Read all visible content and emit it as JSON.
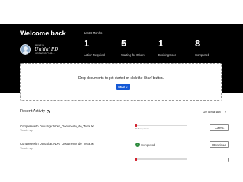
{
  "header": {
    "welcome": "Welcome back",
    "signature": {
      "signed_by": "Signed by:",
      "name": "Unidal PD",
      "code": "969FAE3DF94B..."
    },
    "period": "Last 6 Months",
    "stats": [
      {
        "value": "1",
        "label": "Action Required"
      },
      {
        "value": "5",
        "label": "Waiting for Others"
      },
      {
        "value": "1",
        "label": "Expiring Soon"
      },
      {
        "value": "8",
        "label": "Completed"
      }
    ]
  },
  "dropzone": {
    "text": "Drop documents to get started or click the 'Start' button.",
    "start_label": "Start",
    "start_arrow": "▾"
  },
  "recent_activity": {
    "title": "Recent Activity",
    "info_icon": "ⓘ",
    "manage_link": "Go to Manage",
    "manage_chevron": "›",
    "rows": [
      {
        "title": "Complete with DocuSign: Novo_Documento_de_Teste.txt",
        "time": "2 weeks ago",
        "status_type": "progress",
        "progress": 0.0,
        "status_label": "Delivery failure",
        "button": "Correct"
      },
      {
        "title": "Complete with DocuSign: Novo_Documento_de_Teste.txt",
        "time": "2 weeks ago",
        "status_type": "completed",
        "status_label": "Completed",
        "button": "Download"
      }
    ]
  },
  "colors": {
    "header_bg": "#000000",
    "primary_button": "#1559d6",
    "error": "#d21f2b",
    "success": "#2e8b3e"
  }
}
